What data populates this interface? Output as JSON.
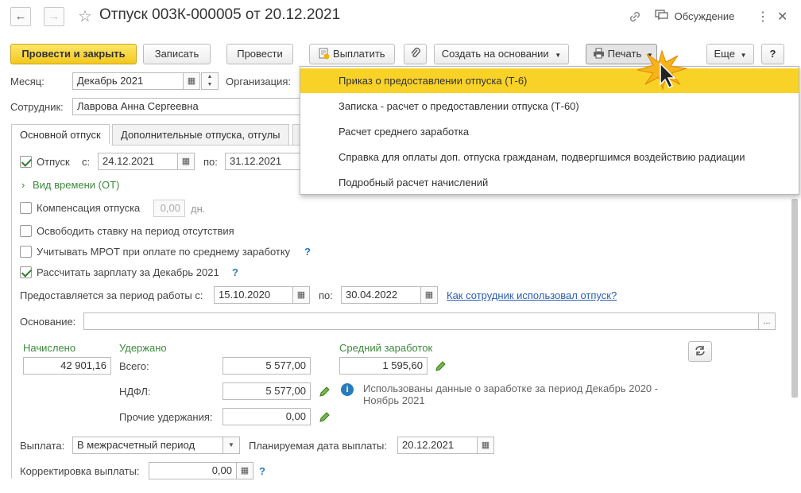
{
  "window": {
    "title": "Отпуск 003К-000005 от 20.12.2021",
    "discussion_label": "Обсуждение",
    "more_dots": "⋮",
    "close": "✕"
  },
  "toolbar": {
    "post_close": "Провести и закрыть",
    "save": "Записать",
    "post": "Провести",
    "pay": "Выплатить",
    "create_based": "Создать на основании",
    "print": "Печать",
    "more": "Еще",
    "help": "?"
  },
  "header": {
    "month_label": "Месяц:",
    "month_value": "Декабрь 2021",
    "org_label": "Организация:",
    "employee_label": "Сотрудник:",
    "employee_value": "Лаврова Анна Сергеевна"
  },
  "tabs": [
    "Основной отпуск",
    "Дополнительные отпуска, отгулы"
  ],
  "leave": {
    "label": "Отпуск",
    "from_label": "с:",
    "from_value": "24.12.2021",
    "to_label": "по:",
    "to_value": "31.12.2021",
    "time_kind": "Вид времени (ОТ)",
    "compensation_label": "Компенсация отпуска",
    "compensation_value": "0,00",
    "compensation_unit": "дн.",
    "release_rate": "Освободить ставку на период отсутствия",
    "mrot": "Учитывать МРОТ при оплате по среднему заработку",
    "calc_salary": "Рассчитать зарплату за Декабрь 2021",
    "period_label": "Предоставляется за период работы с:",
    "period_from": "15.10.2020",
    "period_to_label": "по:",
    "period_to": "30.04.2022",
    "usage_link": "Как сотрудник использовал отпуск?",
    "basis_label": "Основание:",
    "basis_value": "",
    "basis_btn": "..."
  },
  "amounts": {
    "accrued_label": "Начислено",
    "accrued_value": "42 901,16",
    "withheld_label": "Удержано",
    "total_label": "Всего:",
    "total_value": "5 577,00",
    "ndfl_label": "НДФЛ:",
    "ndfl_value": "5 577,00",
    "other_label": "Прочие удержания:",
    "other_value": "0,00",
    "avg_label": "Средний заработок",
    "avg_value": "1 595,60",
    "info_line1": "Использованы данные о заработке за период Декабрь 2020 -",
    "info_line2": "Ноябрь 2021"
  },
  "payment": {
    "label": "Выплата:",
    "value": "В межрасчетный период",
    "planned_label": "Планируемая дата выплаты:",
    "planned_value": "20.12.2021",
    "correction_label": "Корректировка выплаты:",
    "correction_value": "0,00"
  },
  "print_menu": [
    "Приказ о предоставлении отпуска (Т-6)",
    "Записка - расчет о предоставлении отпуска (Т-60)",
    "Расчет среднего заработка",
    "Справка для оплаты доп. отпуска гражданам, подвергшимся воздействию радиации",
    "Подробный расчет начислений"
  ],
  "colors": {
    "primary_button": "#f3c81d",
    "menu_highlight": "#f8d227",
    "green_label": "#3c8a3c",
    "link": "#2a5db0",
    "info_icon": "#2a7bbd"
  },
  "icons": [
    "back-arrow-icon",
    "forward-arrow-icon",
    "star-icon",
    "link-icon",
    "discussion-icon",
    "pay-doc-icon",
    "paperclip-icon",
    "printer-icon",
    "calendar-icon",
    "pencil-icon",
    "refresh-icon",
    "info-icon",
    "cursor-icon"
  ]
}
